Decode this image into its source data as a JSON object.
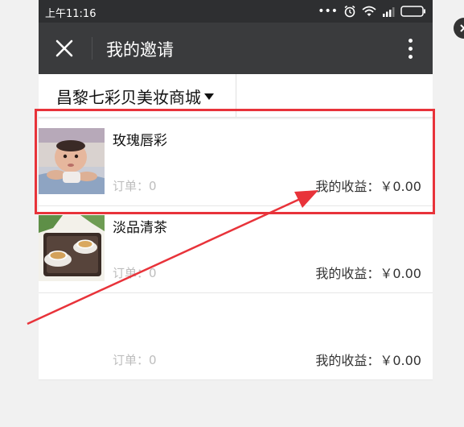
{
  "statusbar": {
    "time": "上午11:16",
    "icons": [
      "more-dots-icon",
      "alarm-icon",
      "wifi-icon",
      "signal-icon",
      "battery-icon"
    ]
  },
  "titlebar": {
    "close_icon": "close-icon",
    "title": "我的邀请",
    "menu_icon": "more-vertical-icon"
  },
  "store_selector": {
    "value": "昌黎七彩贝美妆商城"
  },
  "items": [
    {
      "title": "玫瑰唇彩",
      "orders": "订单：0",
      "earnings": "我的收益：￥0.00",
      "image": "baby-photo"
    },
    {
      "title": "淡品清茶",
      "orders": "订单：0",
      "earnings": "我的收益：￥0.00",
      "image": "tea-cups-photo"
    },
    {
      "title": "",
      "orders": "订单：0",
      "earnings": "我的收益：￥0.00",
      "image": ""
    }
  ],
  "annotation": {
    "highlight_color": "#e8333a",
    "arrow_color": "#e8333a"
  }
}
